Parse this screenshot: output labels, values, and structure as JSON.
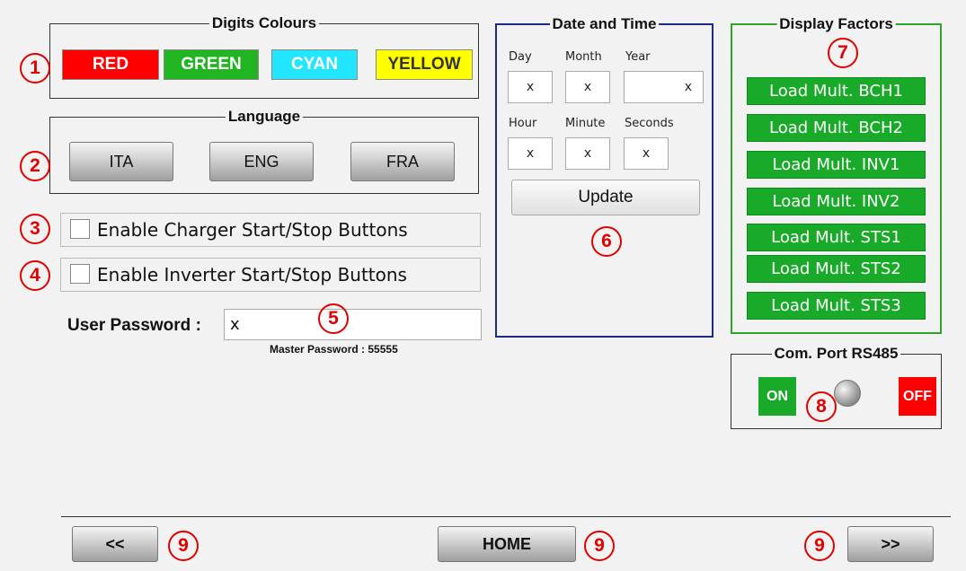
{
  "digits_colours": {
    "title": "Digits Colours",
    "buttons": [
      {
        "label": "RED",
        "bg": "#ff0000",
        "fg": "#ffffff"
      },
      {
        "label": "GREEN",
        "bg": "#22b522",
        "fg": "#ffffff"
      },
      {
        "label": "CYAN",
        "bg": "#22e5ff",
        "fg": "#ffffff"
      },
      {
        "label": "YELLOW",
        "bg": "#ffff00",
        "fg": "#333333"
      }
    ]
  },
  "language": {
    "title": "Language",
    "buttons": [
      "ITA",
      "ENG",
      "FRA"
    ]
  },
  "checkboxes": {
    "charger": "Enable Charger Start/Stop Buttons",
    "inverter": "Enable Inverter Start/Stop Buttons"
  },
  "password": {
    "label": "User Password :",
    "value": "x",
    "master": "Master Password : 55555"
  },
  "date_time": {
    "title": "Date and Time",
    "labels": [
      "Day",
      "Month",
      "Year",
      "Hour",
      "Minute",
      "Seconds"
    ],
    "values": [
      "x",
      "x",
      "x",
      "x",
      "x",
      "x"
    ],
    "update_label": "Update"
  },
  "display_factors": {
    "title": "Display Factors",
    "items": [
      "Load Mult. BCH1",
      "Load Mult. BCH2",
      "Load Mult. INV1",
      "Load Mult. INV2",
      "Load Mult. STS1",
      "Load Mult. STS2",
      "Load Mult. STS3"
    ]
  },
  "com_port": {
    "title": "Com. Port RS485",
    "on_label": "ON",
    "off_label": "OFF"
  },
  "nav": {
    "prev": "<<",
    "home": "HOME",
    "next": ">>"
  },
  "markers": [
    "1",
    "2",
    "3",
    "4",
    "5",
    "6",
    "7",
    "8",
    "9",
    "9",
    "9"
  ],
  "colors": {
    "accent_green": "#1aaa2a",
    "accent_red": "#ff0000",
    "marker_red": "#e00000",
    "date_border": "#1a2a8a"
  }
}
